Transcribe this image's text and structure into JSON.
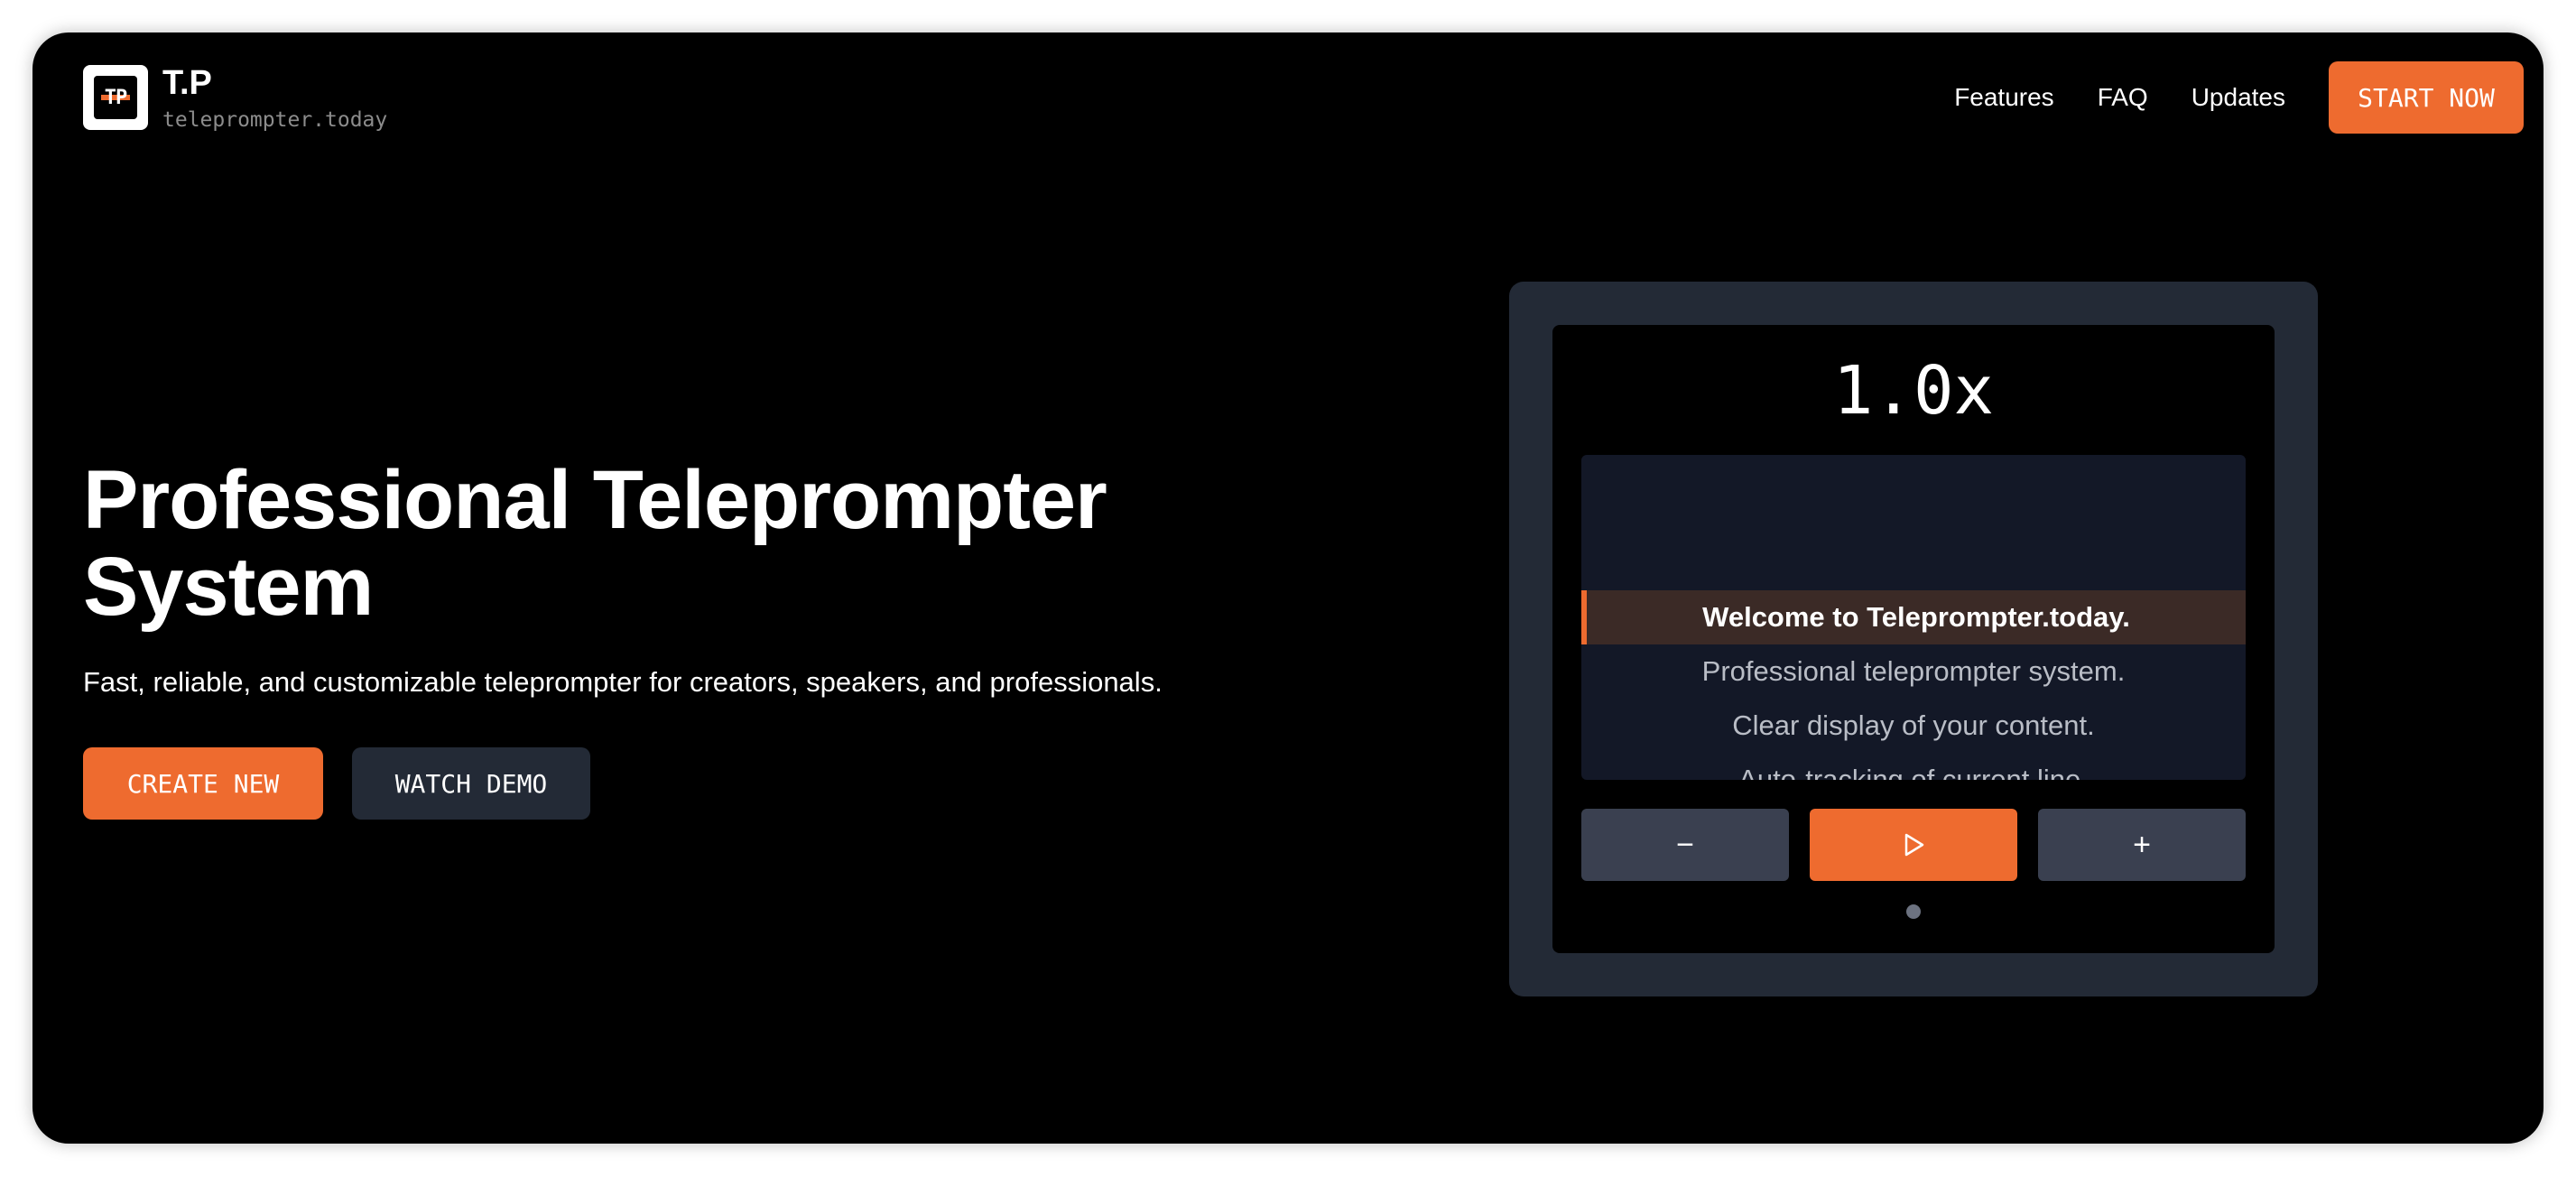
{
  "brand": {
    "logo_text": "TP",
    "title": "T.P",
    "subtitle": "teleprompter.today"
  },
  "nav": {
    "links": [
      "Features",
      "FAQ",
      "Updates"
    ],
    "cta_label": "START NOW"
  },
  "hero": {
    "title_line1": "Professional Teleprompter",
    "title_line2": "System",
    "subtitle": "Fast, reliable, and customizable teleprompter for creators, speakers, and professionals.",
    "primary_label": "CREATE NEW",
    "secondary_label": "WATCH DEMO"
  },
  "preview": {
    "speed": "1.0x",
    "lines": [
      "Welcome to Teleprompter.today.",
      "Professional teleprompter system.",
      "Clear display of your content.",
      "Auto-tracking of current line."
    ],
    "active_line_index": 0,
    "controls": {
      "decrease_icon": "minus-icon",
      "play_icon": "play-icon",
      "increase_icon": "plus-icon",
      "decrease_glyph": "−",
      "increase_glyph": "+"
    },
    "page_dots": 1
  },
  "colors": {
    "accent": "#ee6b2f",
    "background": "#000000",
    "panel": "#232a36",
    "script_bg": "#131827",
    "active_line_bg": "#3b2a26"
  }
}
